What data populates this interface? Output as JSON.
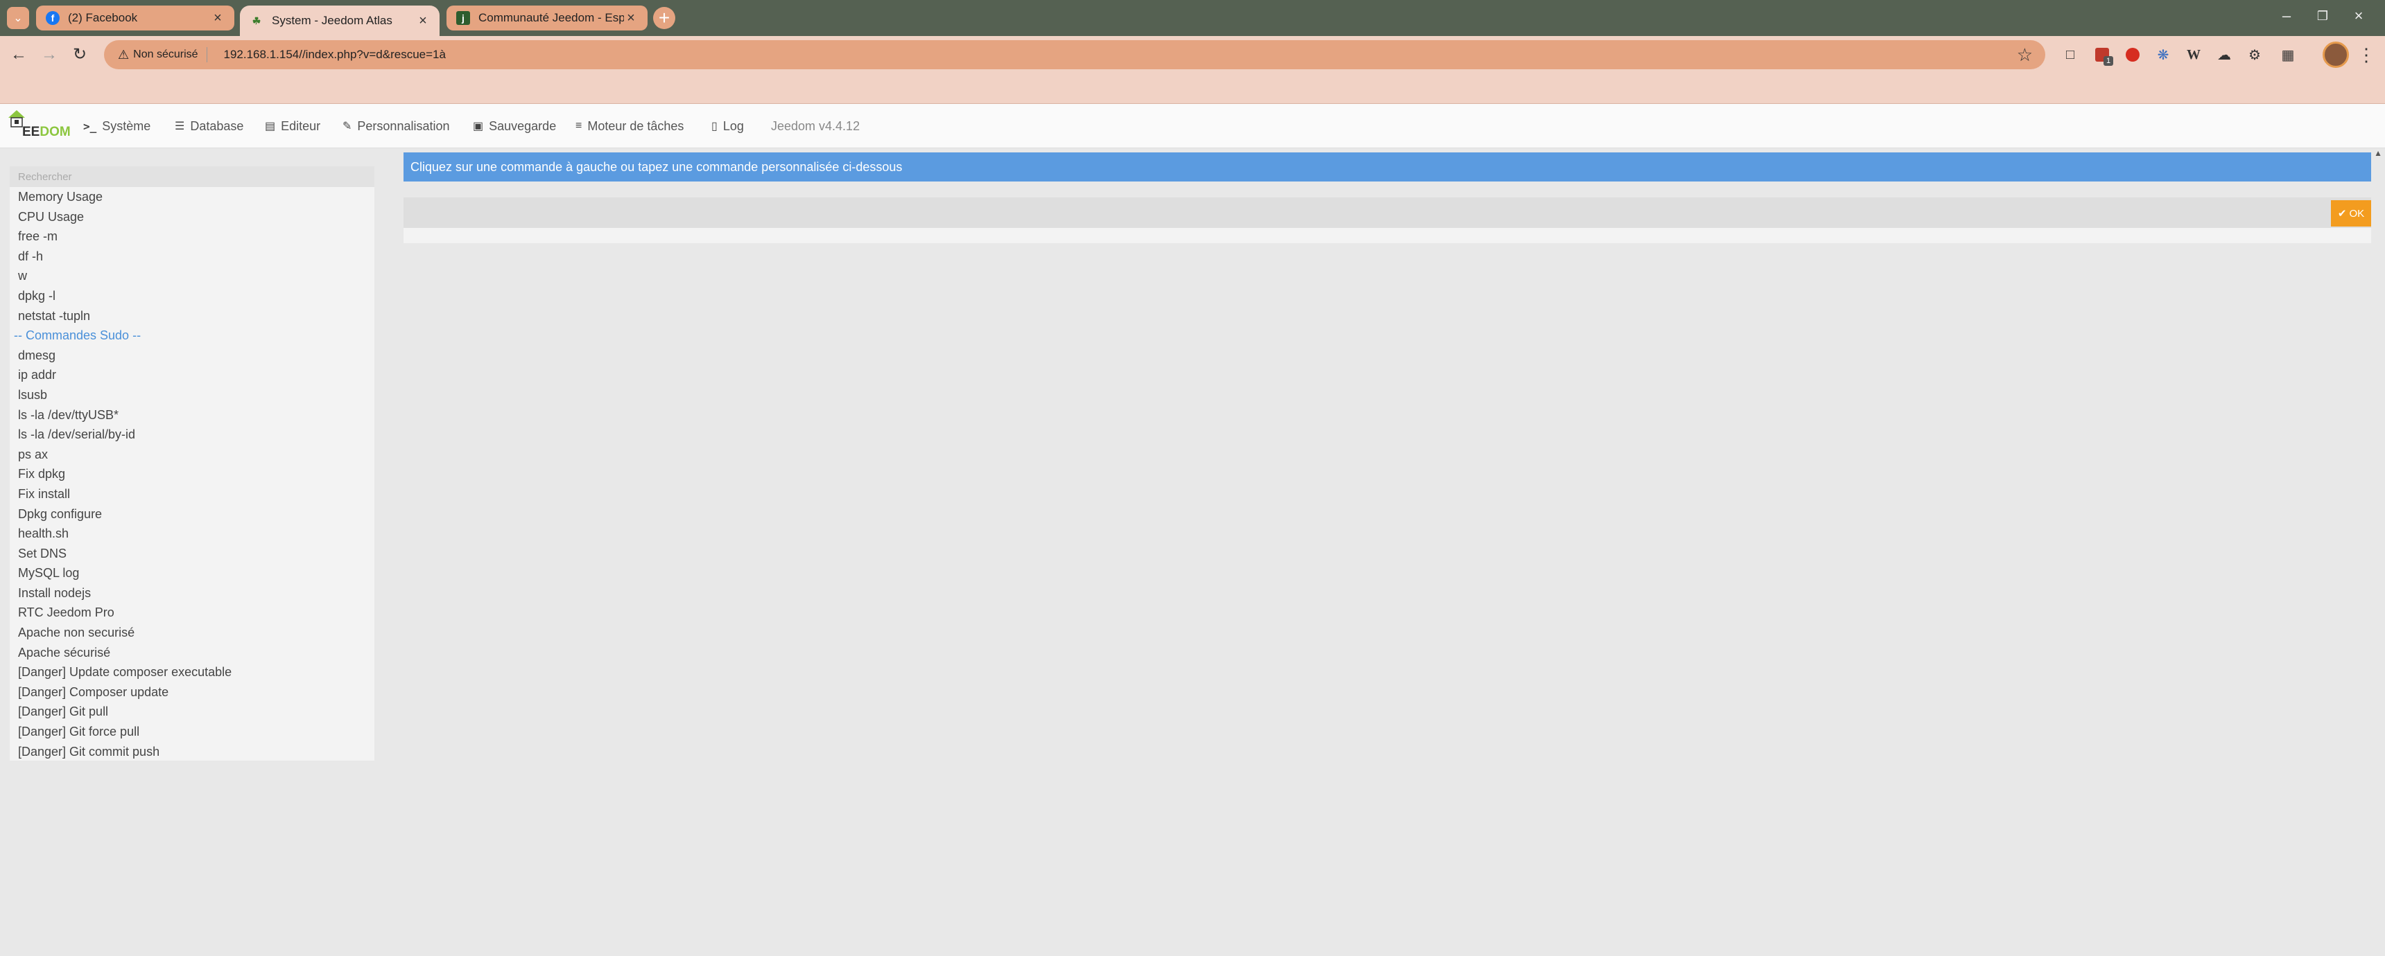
{
  "browser": {
    "tabs": [
      {
        "title": "(2) Facebook",
        "state": "inactive",
        "favicon": "facebook-icon"
      },
      {
        "title": "System - Jeedom Atlas",
        "state": "active",
        "favicon": "jeedom-icon"
      },
      {
        "title": "Communauté Jeedom - Espace",
        "state": "inactive",
        "favicon": "community-icon"
      }
    ],
    "security_label": "Non sécurisé",
    "url": "192.168.1.154//index.php?v=d&rescue=1à",
    "extension_badge": "1",
    "colors": {
      "tabbar": "#556152",
      "toolbar": "#f1d2c5",
      "omnibox": "#e5a481"
    }
  },
  "navbar": {
    "items": [
      {
        "label": "Système",
        "icon": "terminal-icon"
      },
      {
        "label": "Database",
        "icon": "database-icon"
      },
      {
        "label": "Editeur",
        "icon": "editor-icon"
      },
      {
        "label": "Personnalisation",
        "icon": "edit-icon"
      },
      {
        "label": "Sauvegarde",
        "icon": "save-icon"
      },
      {
        "label": "Moteur de tâches",
        "icon": "list-icon"
      },
      {
        "label": "Log",
        "icon": "file-icon"
      }
    ],
    "version": "Jeedom v4.4.12",
    "logo": {
      "text_e": "EE",
      "text_dom": "DOM",
      "letter": "J"
    }
  },
  "sidebar": {
    "search_placeholder": "Rechercher",
    "commands": [
      "Memory Usage",
      "CPU Usage",
      "free -m",
      "df -h",
      "w",
      "dpkg -l",
      "netstat -tupln",
      "-- Commandes Sudo --",
      "dmesg",
      "ip addr",
      "lsusb",
      "ls -la /dev/ttyUSB*",
      "ls -la /dev/serial/by-id",
      "ps ax",
      "Fix dpkg",
      "Fix install",
      "Dpkg configure",
      "health.sh",
      "Set DNS",
      "MySQL log",
      "Install nodejs",
      "RTC Jeedom Pro",
      "Apache non securisé",
      "Apache sécurisé",
      "[Danger] Update composer executable",
      "[Danger] Composer update",
      "[Danger] Git pull",
      "[Danger] Git force pull",
      "[Danger] Git commit push"
    ]
  },
  "main": {
    "banner": "Cliquez sur une commande à gauche ou tapez une commande personnalisée ci-dessous",
    "custom_command_value": "",
    "ok_label": "OK",
    "colors": {
      "banner": "#5b9be0",
      "ok": "#f39c1f",
      "separator": "#4a90d9"
    }
  }
}
